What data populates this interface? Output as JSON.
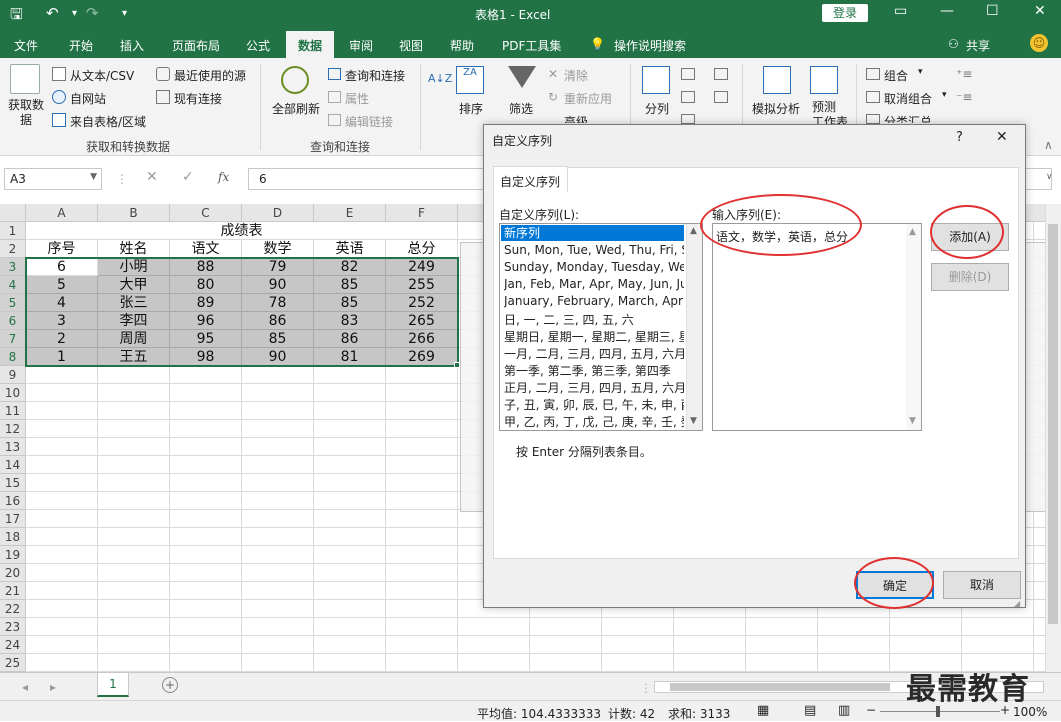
{
  "window": {
    "title": "表格1  -  Excel",
    "login": "登录"
  },
  "tabs": [
    "文件",
    "开始",
    "插入",
    "页面布局",
    "公式",
    "数据",
    "审阅",
    "视图",
    "帮助",
    "PDF工具集",
    "操作说明搜索"
  ],
  "active_tab": "数据",
  "share": "共享",
  "ribbon": {
    "get_data": "获取数\n据",
    "from_text_csv": "从文本/CSV",
    "from_web": "自网站",
    "from_table": "来自表格/区域",
    "recent_sources": "最近使用的源",
    "existing_connections": "现有连接",
    "group_get_transform": "获取和转换数据",
    "refresh_all": "全部刷新",
    "queries_connections": "查询和连接",
    "properties": "属性",
    "edit_links": "编辑链接",
    "group_queries": "查询和连接",
    "sort": "排序",
    "filter": "筛选",
    "clear": "清除",
    "reapply": "重新应用",
    "advanced": "高级",
    "text_to_columns": "分列",
    "what_if": "模拟分析",
    "forecast_sheet": "预测\n工作表",
    "group": "组合",
    "ungroup": "取消组合",
    "subtotal": "分类汇总"
  },
  "formula_bar": {
    "name_box": "A3",
    "fx": "fx",
    "value": "6"
  },
  "columns": [
    "A",
    "B",
    "C",
    "D",
    "E",
    "F"
  ],
  "sheet": {
    "title": "成绩表",
    "headers": [
      "序号",
      "姓名",
      "语文",
      "数学",
      "英语",
      "总分"
    ],
    "rows": [
      [
        "6",
        "小明",
        "88",
        "79",
        "82",
        "249"
      ],
      [
        "5",
        "大甲",
        "80",
        "90",
        "85",
        "255"
      ],
      [
        "4",
        "张三",
        "89",
        "78",
        "85",
        "252"
      ],
      [
        "3",
        "李四",
        "96",
        "86",
        "83",
        "265"
      ],
      [
        "2",
        "周周",
        "95",
        "85",
        "86",
        "266"
      ],
      [
        "1",
        "王五",
        "98",
        "90",
        "81",
        "269"
      ]
    ],
    "row_numbers": [
      "1",
      "2",
      "3",
      "4",
      "5",
      "6",
      "7",
      "8",
      "9",
      "10",
      "11",
      "12",
      "13",
      "14",
      "15",
      "16",
      "17",
      "18",
      "19",
      "20",
      "21",
      "22",
      "23",
      "24",
      "25"
    ]
  },
  "sheet_tab": "1",
  "status": {
    "average": "平均值: 104.4333333",
    "count": "计数: 42",
    "sum": "求和: 3133",
    "zoom": "100%"
  },
  "dialog": {
    "title": "自定义序列",
    "help": "?",
    "tab": "自定义序列",
    "list_label": "自定义序列(L):",
    "entry_label": "输入序列(E):",
    "lists": [
      "新序列",
      "Sun, Mon, Tue, Wed, Thu, Fri, Sat",
      "Sunday, Monday, Tuesday, Wednesday",
      "Jan, Feb, Mar, Apr, May, Jun, Jul",
      "January, February, March, April",
      "日, 一, 二, 三, 四, 五, 六",
      "星期日, 星期一, 星期二, 星期三, 星期四",
      "一月, 二月, 三月, 四月, 五月, 六月",
      "第一季, 第二季, 第三季, 第四季",
      "正月, 二月, 三月, 四月, 五月, 六月",
      "子, 丑, 寅, 卯, 辰, 巳, 午, 未, 申, 酉",
      "甲, 乙, 丙, 丁, 戊, 己, 庚, 辛, 壬, 癸"
    ],
    "entry_value": "语文，数学，英语，总分",
    "add": "添加(A)",
    "delete": "删除(D)",
    "hint": "按 Enter 分隔列表条目。",
    "ok": "确定",
    "cancel": "取消"
  },
  "watermark": "最需教育",
  "colors": {
    "excel_green": "#217346",
    "selection_fill": "#c6c6c6",
    "annotation_red": "#e03030",
    "dialog_list_select": "#0078d7"
  }
}
